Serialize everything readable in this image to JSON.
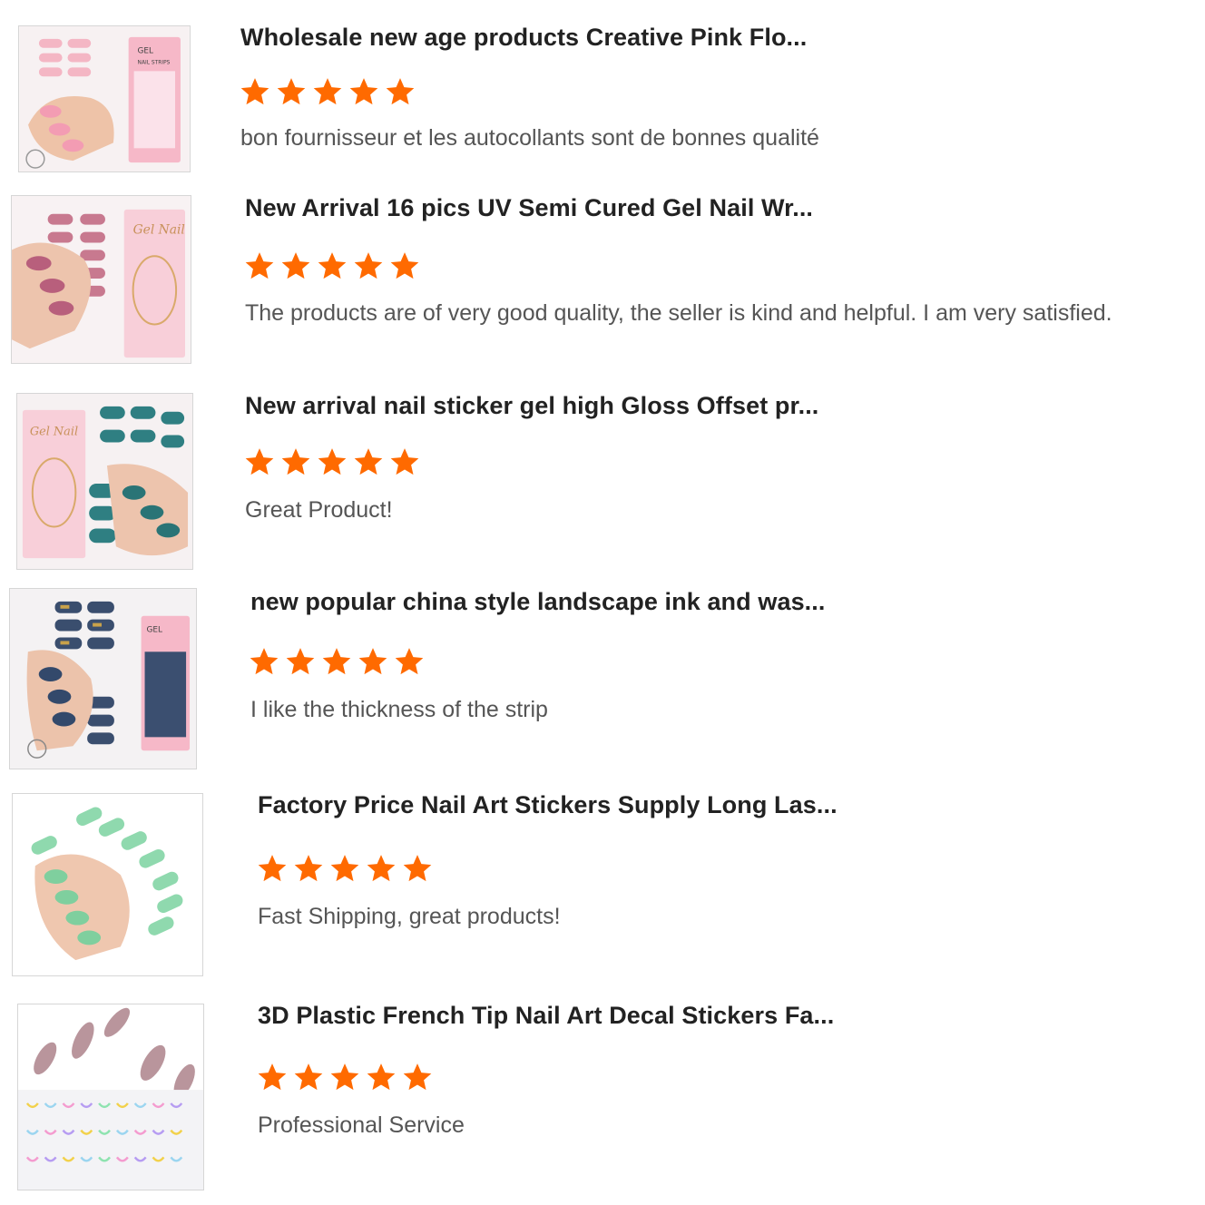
{
  "star_color": "#ff6a00",
  "reviews": [
    {
      "title": "Wholesale new age products Creative Pink Flo...",
      "rating": 5,
      "comment": "bon fournisseur et les autocollants sont de bonnes qualité",
      "image_icon": "pink-floral-nail-strips-image"
    },
    {
      "title": "New Arrival 16 pics UV Semi Cured Gel Nail Wr...",
      "rating": 5,
      "comment": "The products are of very good quality, the seller is kind and helpful. I am very satisfied.",
      "image_icon": "mauve-gel-nail-wraps-image"
    },
    {
      "title": "New arrival nail sticker gel high Gloss Offset pr...",
      "rating": 5,
      "comment": "Great Product!",
      "image_icon": "teal-gloss-nail-sticker-image"
    },
    {
      "title": "new popular china style landscape ink and was...",
      "rating": 5,
      "comment": "I like the thickness of the strip",
      "image_icon": "ink-landscape-nail-strips-image"
    },
    {
      "title": "Factory Price Nail Art Stickers Supply Long Las...",
      "rating": 5,
      "comment": "Fast Shipping, great products!",
      "image_icon": "mint-green-nail-stickers-image"
    },
    {
      "title": "3D Plastic French Tip Nail Art Decal Stickers Fa...",
      "rating": 5,
      "comment": "Professional Service",
      "image_icon": "french-tip-decal-stickers-image"
    }
  ]
}
